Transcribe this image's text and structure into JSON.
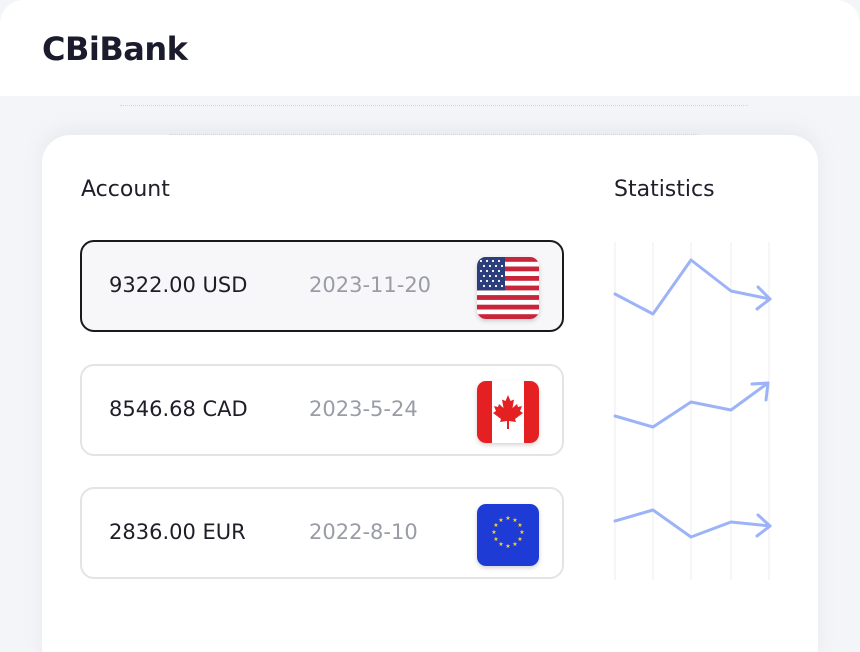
{
  "app": {
    "title": "CBiBank"
  },
  "sections": {
    "account_title": "Account",
    "statistics_title": "Statistics"
  },
  "accounts": [
    {
      "amount": "9322.00 USD",
      "date": "2023-11-20",
      "flag": "us-flag-icon",
      "active": true
    },
    {
      "amount": "8546.68 CAD",
      "date": "2023-5-24",
      "flag": "canada-flag-icon",
      "active": false
    },
    {
      "amount": "2836.00 EUR",
      "date": "2022-8-10",
      "flag": "eu-flag-icon",
      "active": false
    }
  ],
  "colors": {
    "accent_line": "#9cb3f7",
    "text_dark": "#1e1e26",
    "text_muted": "#9a9ca6",
    "active_border": "#1a1a1a"
  }
}
